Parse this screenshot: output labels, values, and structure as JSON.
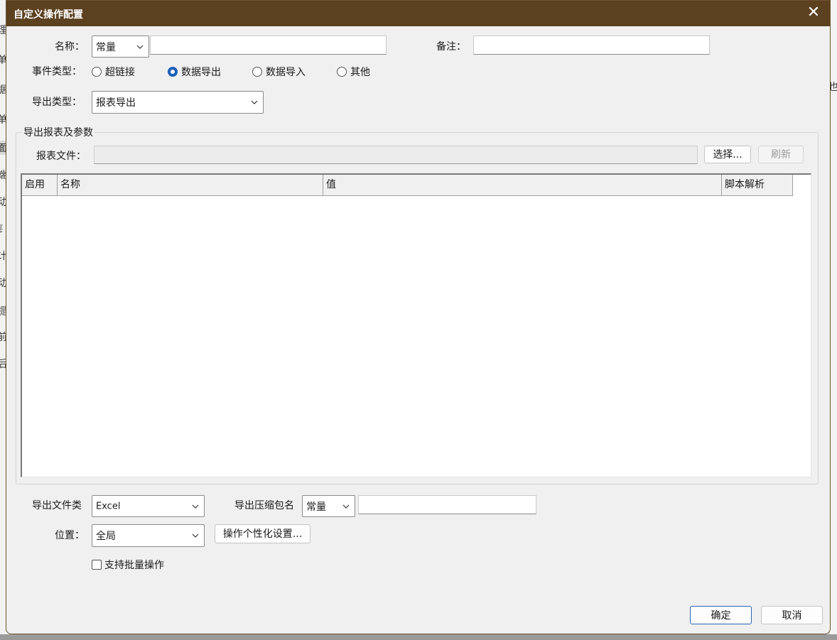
{
  "dialog": {
    "title": "自定义操作配置",
    "close_glyph": "✕"
  },
  "background": {
    "left_chars": [
      "理",
      "单",
      "据",
      "单",
      "面",
      "端",
      "动",
      "钅",
      "计",
      "动",
      "提",
      "前",
      "后"
    ],
    "right_char": "也"
  },
  "name_row": {
    "label": "名称：",
    "type_value": "常量",
    "text_value": "",
    "remark_label": "备注：",
    "remark_value": ""
  },
  "event_type": {
    "label": "事件类型：",
    "options": [
      {
        "label": "超链接",
        "selected": false
      },
      {
        "label": "数据导出",
        "selected": true
      },
      {
        "label": "数据导入",
        "selected": false
      },
      {
        "label": "其他",
        "selected": false
      }
    ]
  },
  "export_type": {
    "label": "导出类型：",
    "value": "报表导出"
  },
  "group": {
    "title": "导出报表及参数",
    "report_file_label": "报表文件：",
    "report_file_value": "",
    "select_button": "选择...",
    "refresh_button": "刷新"
  },
  "table": {
    "columns": [
      "启用",
      "名称",
      "值",
      "脚本解析"
    ],
    "rows": []
  },
  "bottom": {
    "file_type_label": "导出文件类",
    "file_type_value": "Excel",
    "zip_name_label": "导出压缩包名",
    "zip_name_type": "常量",
    "zip_name_value": "",
    "location_label": "位置：",
    "location_value": "全局",
    "personalize_button": "操作个性化设置...",
    "batch_label": "支持批量操作",
    "batch_checked": false
  },
  "footer": {
    "ok_button": "确定",
    "cancel_button": "取消"
  },
  "colors": {
    "titlebar": "#5c4120",
    "accent": "#1d5fb8"
  }
}
